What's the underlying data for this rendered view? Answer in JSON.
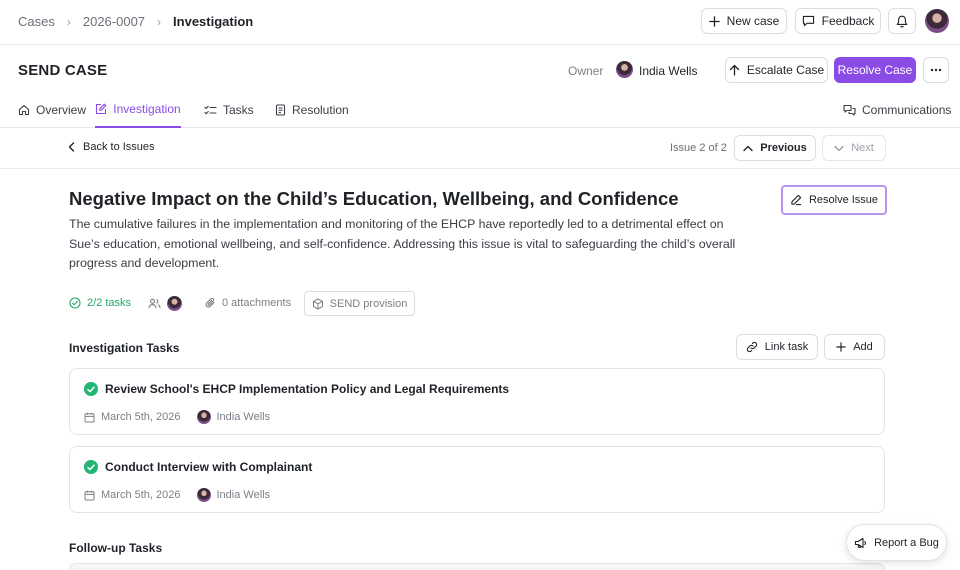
{
  "breadcrumb": {
    "items": [
      "Cases",
      "2026-0007",
      "Investigation"
    ]
  },
  "topbar": {
    "new_case_label": "New case",
    "feedback_label": "Feedback"
  },
  "case": {
    "title": "SEND CASE",
    "owner_label": "Owner",
    "owner_name": "India Wells",
    "escalate_label": "Escalate Case",
    "resolve_label": "Resolve Case"
  },
  "tabs": [
    {
      "label": "Overview",
      "icon": "home-icon"
    },
    {
      "label": "Investigation",
      "icon": "edit-square-icon",
      "active": true
    },
    {
      "label": "Tasks",
      "icon": "checklist-icon"
    },
    {
      "label": "Resolution",
      "icon": "document-icon"
    }
  ],
  "communications_label": "Communications",
  "issue_nav": {
    "back_label": "Back to Issues",
    "count_label": "Issue 2 of 2",
    "previous_label": "Previous",
    "next_label": "Next"
  },
  "issue": {
    "title": "Negative Impact on the Child’s Education, Wellbeing, and Confidence",
    "description": "The cumulative failures in the implementation and monitoring of the EHCP have reportedly led to a detrimental effect on Sue’s education, emotional wellbeing, and self-confidence. Addressing this issue is vital to safeguarding the child’s overall progress and development.",
    "resolve_label": "Resolve Issue",
    "tasks_label": "2/2 tasks",
    "attachments_label": "0 attachments",
    "provision_label": "SEND provision"
  },
  "investigation_tasks": {
    "title": "Investigation Tasks",
    "link_label": "Link task",
    "add_label": "Add",
    "items": [
      {
        "title": "Review School's EHCP Implementation Policy and Legal Requirements",
        "date": "March 5th, 2026",
        "assignee": "India Wells"
      },
      {
        "title": "Conduct Interview with Complainant",
        "date": "March 5th, 2026",
        "assignee": "India Wells"
      }
    ]
  },
  "followup_title": "Follow-up Tasks",
  "report_bug_label": "Report a Bug",
  "colors": {
    "accent": "#8b4ce6",
    "success": "#22b573"
  }
}
